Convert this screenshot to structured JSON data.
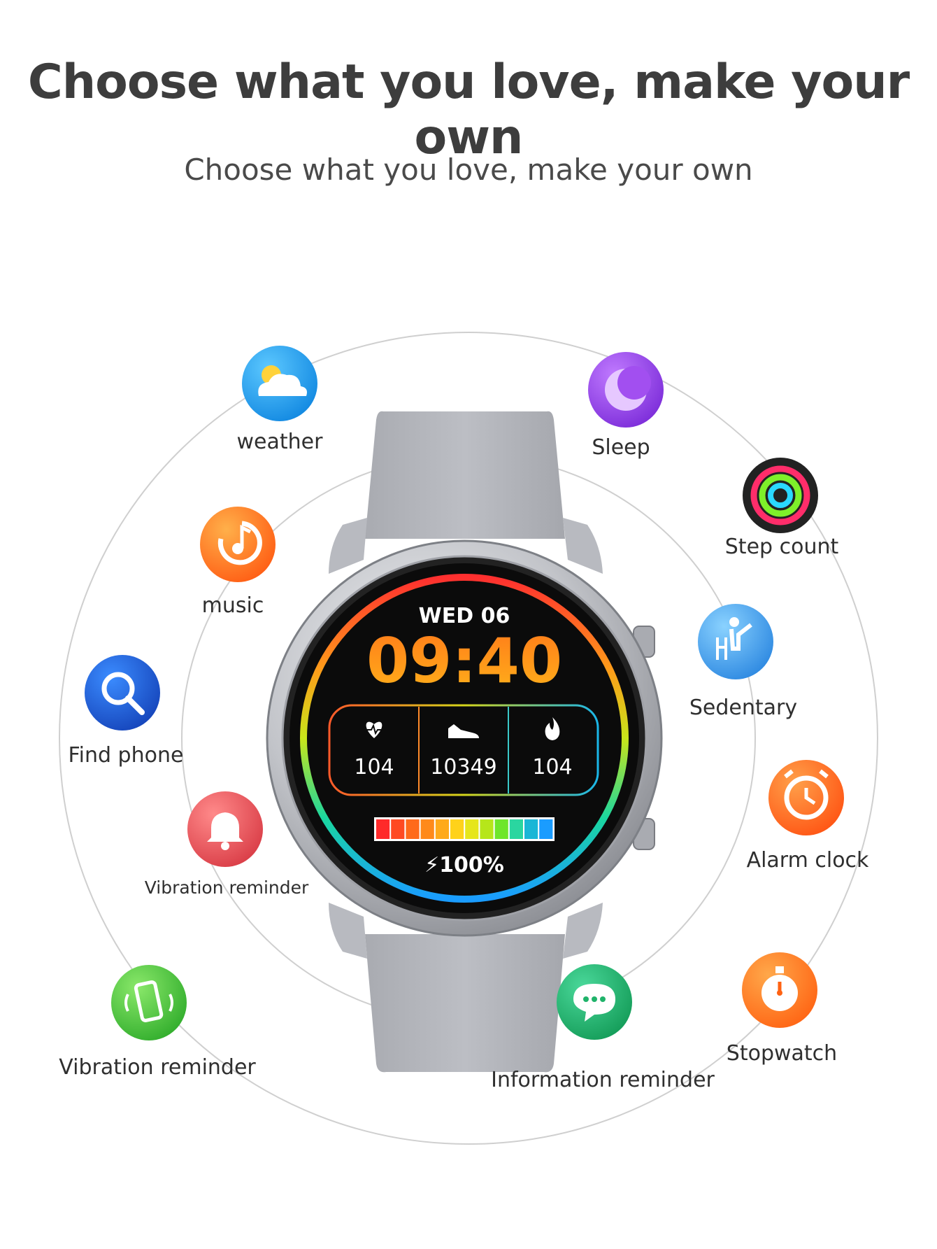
{
  "header": {
    "title": "Choose what you love, make your own",
    "subtitle": "Choose what you love, make your own"
  },
  "watch": {
    "date": "WED 06",
    "time": "09:40",
    "heart_rate": "104",
    "steps": "10349",
    "calories": "104",
    "battery": "100%"
  },
  "features": {
    "weather": "weather",
    "sleep": "Sleep",
    "step_count": "Step count",
    "music": "music",
    "sedentary": "Sedentary",
    "find_phone": "Find phone",
    "alarm_clock": "Alarm clock",
    "vibration_reminder_bell": "Vibration reminder",
    "vibration_reminder_phone": "Vibration reminder",
    "information_reminder": "Information reminder",
    "stopwatch": "Stopwatch"
  },
  "colors": {
    "strap": "#b4b6bc",
    "bezel": "#c9cbd0",
    "weather": "#1aa0f0",
    "sleep": "#9b45e8",
    "music": "#ff7a1a",
    "find_phone": "#1c5fd6",
    "bell": "#e8545a",
    "phone": "#4cc93a",
    "sedentary": "#3a9ef0",
    "alarm": "#ff6a13",
    "message": "#1fb36a",
    "stopwatch": "#ff7a1a"
  }
}
